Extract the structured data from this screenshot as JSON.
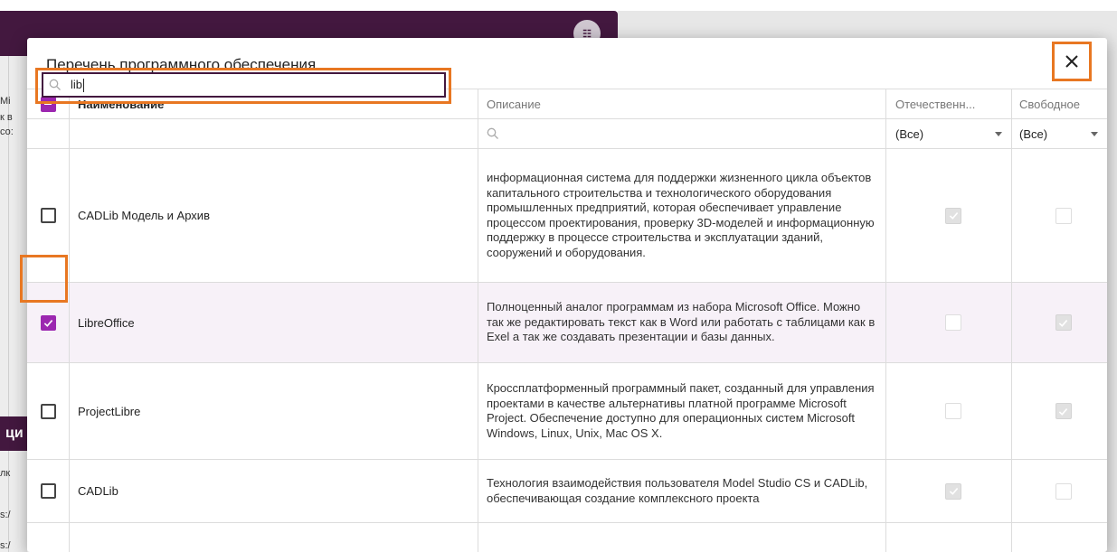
{
  "background": {
    "header_button_icon": "list-settings-icon",
    "header_button_glyph": "☷",
    "left_fragments": [
      "Mi",
      "к в",
      "со:",
      "ци",
      "лк",
      "s:/",
      "s:/"
    ]
  },
  "dialog": {
    "title": "Перечень программного обеспечения",
    "close_icon": "close-icon"
  },
  "columns": {
    "name": "Наименование",
    "description": "Описание",
    "domestic": "Отечественн...",
    "free": "Свободное"
  },
  "filters": {
    "name_value": "lib",
    "description_value": "",
    "domestic_selected": "(Все)",
    "free_selected": "(Все)"
  },
  "rows": [
    {
      "name": "CADLib Модель и Архив",
      "description": "информационная система для поддержки жизненного цикла объектов капитального строительства и технологического оборудования промышленных предприятий, которая обеспечивает управление процессом проектирования, проверку 3D-моделей и информационную поддержку в процессе строительства и эксплуатации зданий, сооружений и оборудования.",
      "selected": false,
      "domestic": true,
      "free": false
    },
    {
      "name": "LibreOffice",
      "description": "Полноценный аналог программам из набора Microsoft Office. Можно так же редактировать текст как в Word или работать с таблицами как в Exel а так же создавать презентации и базы данных.",
      "selected": true,
      "domestic": false,
      "free": true
    },
    {
      "name": "ProjectLibre",
      "description": "Кроссплатформенный программный пакет, созданный для управления проектами в качестве альтернативы платной программе Microsoft Project. Обеспечение доступно для операционных систем Microsoft Windows, Linux, Unix, Mac OS X.",
      "selected": false,
      "domestic": false,
      "free": true
    },
    {
      "name": "CADLib",
      "description": "Технология взаимодействия пользователя Model Studio CS и CADLib, обеспечивающая создание комплексного проекта",
      "selected": false,
      "domestic": true,
      "free": false
    }
  ],
  "colors": {
    "accent_purple": "#9c27b0",
    "header_dark": "#43183f",
    "highlight_orange": "#e87722"
  }
}
